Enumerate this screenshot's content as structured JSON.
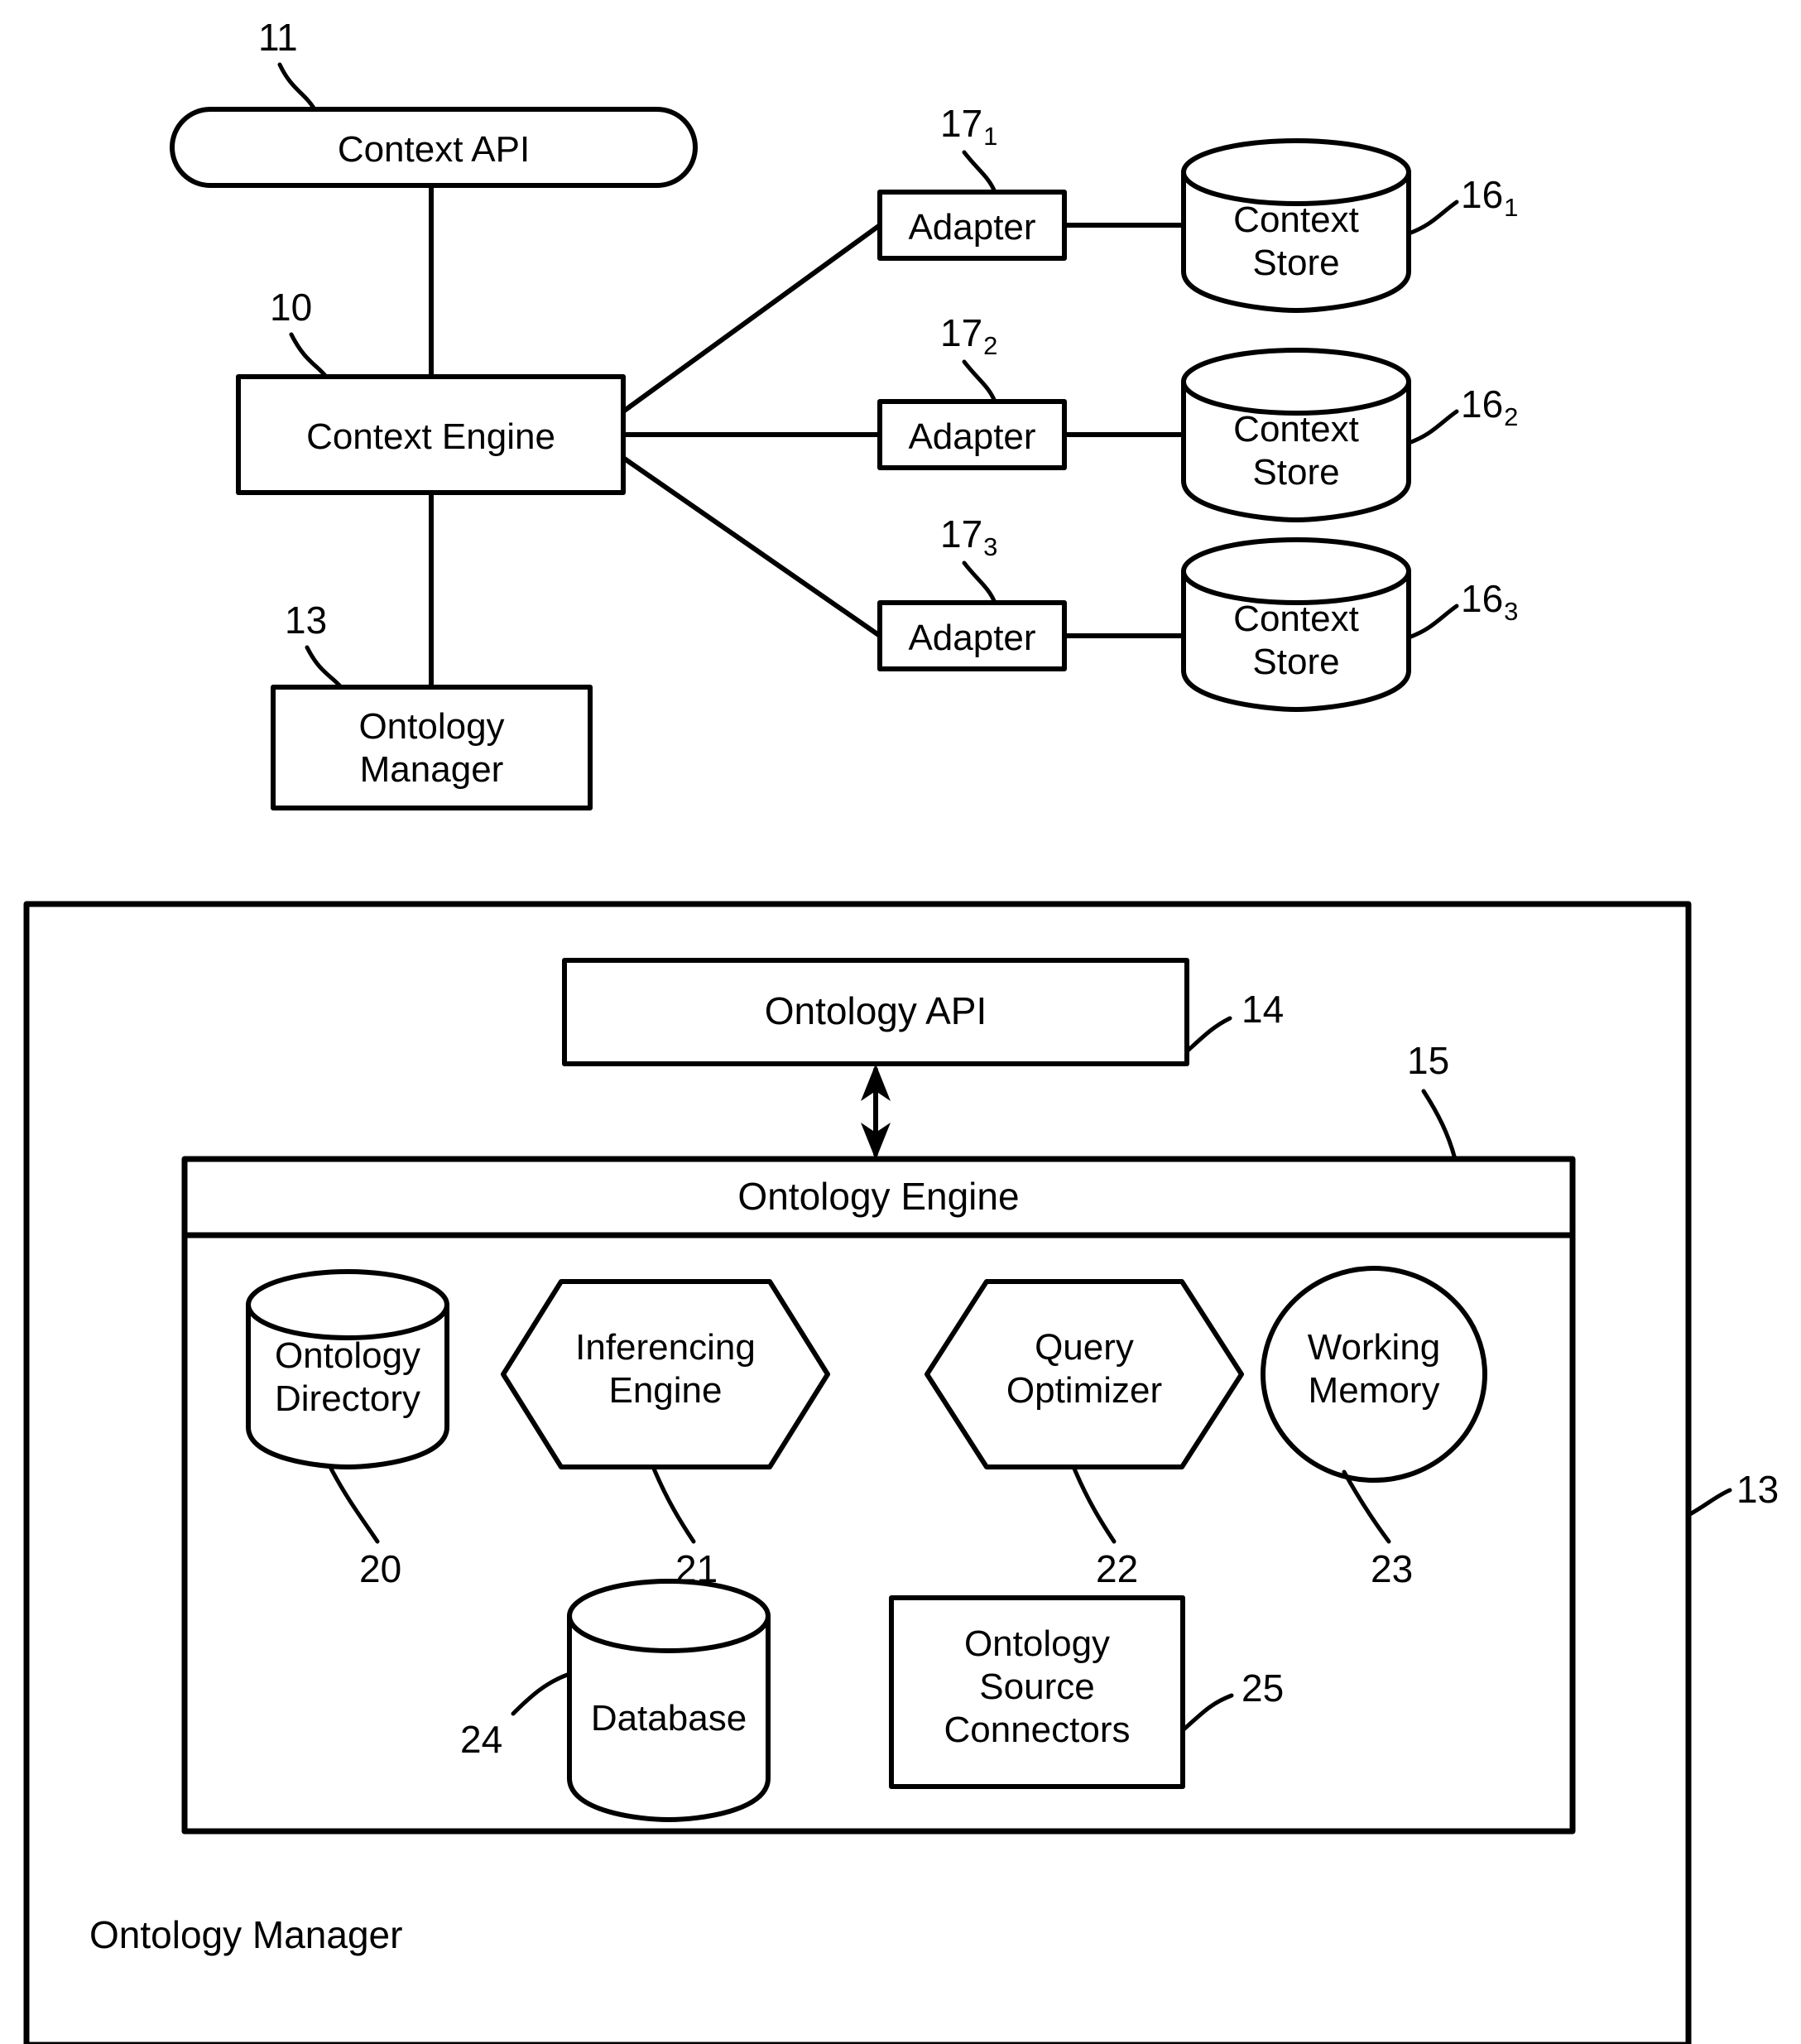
{
  "figure": {
    "title": "Context Engine and Ontology Manager block diagram"
  },
  "top_diagram": {
    "context_api": {
      "label": "Context API",
      "ref": "11"
    },
    "context_engine": {
      "label": "Context Engine",
      "ref": "10"
    },
    "ontology_manager": {
      "label": "Ontology\nManager",
      "ref": "13"
    },
    "branches": [
      {
        "adapter": {
          "label": "Adapter",
          "ref_base": "17",
          "ref_sub": "1"
        },
        "store": {
          "label": "Context\nStore",
          "ref_base": "16",
          "ref_sub": "1"
        }
      },
      {
        "adapter": {
          "label": "Adapter",
          "ref_base": "17",
          "ref_sub": "2"
        },
        "store": {
          "label": "Context\nStore",
          "ref_base": "16",
          "ref_sub": "2"
        }
      },
      {
        "adapter": {
          "label": "Adapter",
          "ref_base": "17",
          "ref_sub": "3"
        },
        "store": {
          "label": "Context\nStore",
          "ref_base": "16",
          "ref_sub": "3"
        }
      }
    ]
  },
  "bottom_diagram": {
    "outer": {
      "label": "Ontology Manager",
      "ref": "13"
    },
    "ontology_api": {
      "label": "Ontology API",
      "ref": "14"
    },
    "ontology_engine": {
      "label": "Ontology Engine",
      "ref": "15"
    },
    "components_row1": [
      {
        "label": "Ontology\nDirectory",
        "ref": "20",
        "shape": "cylinder"
      },
      {
        "label": "Inferencing\nEngine",
        "ref": "21",
        "shape": "hexagon"
      },
      {
        "label": "Query\nOptimizer",
        "ref": "22",
        "shape": "hexagon"
      },
      {
        "label": "Working\nMemory",
        "ref": "23",
        "shape": "ellipse"
      }
    ],
    "components_row2": [
      {
        "label": "Database",
        "ref": "24",
        "shape": "cylinder"
      },
      {
        "label": "Ontology\nSource\nConnectors",
        "ref": "25",
        "shape": "rect"
      }
    ]
  },
  "colors": {
    "ink": "#000000",
    "paper": "#ffffff"
  }
}
